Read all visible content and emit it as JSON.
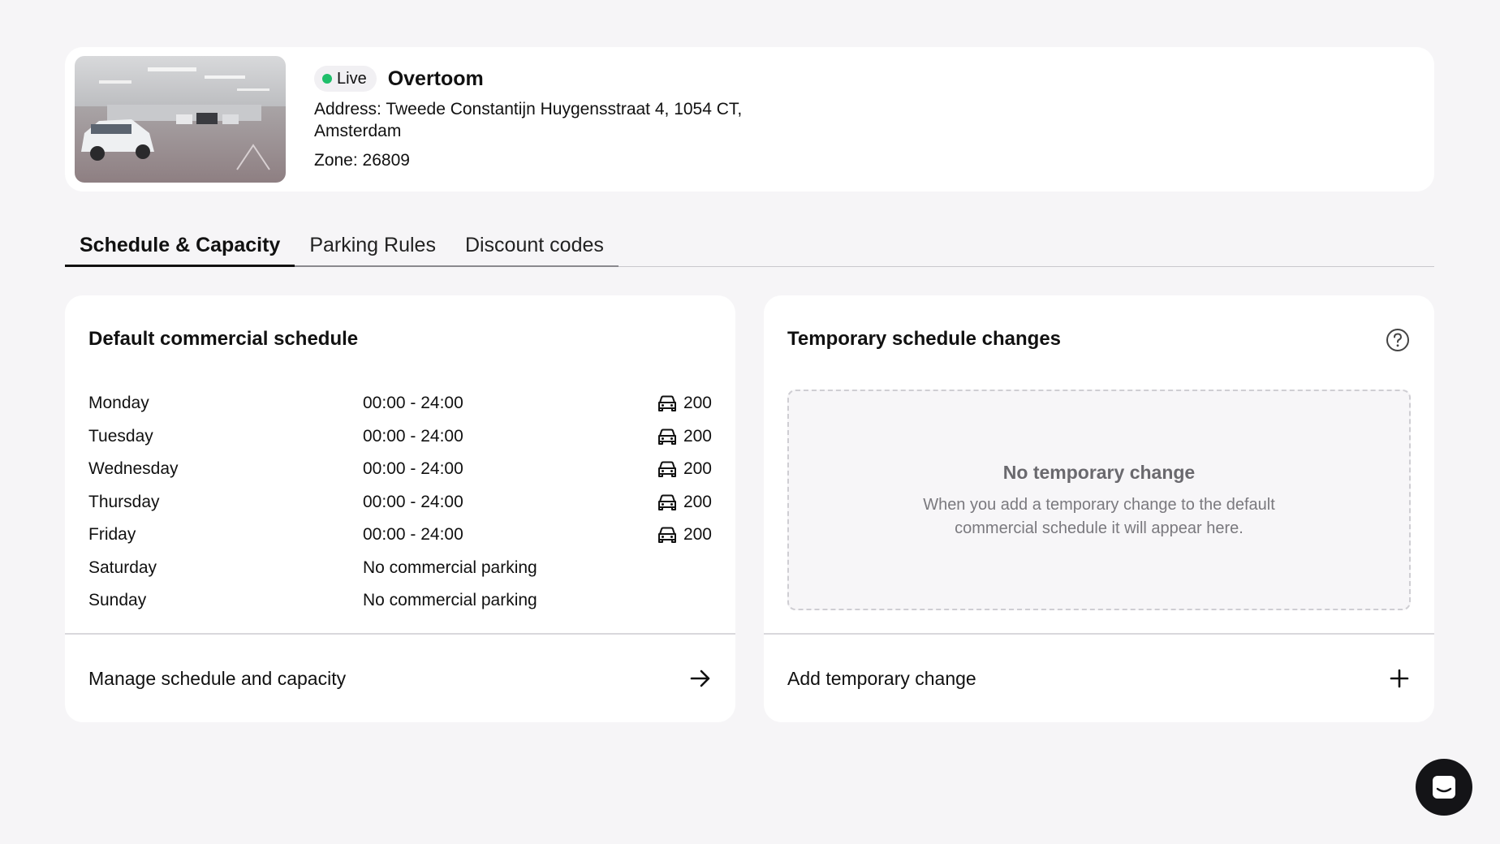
{
  "location": {
    "status": "Live",
    "name": "Overtoom",
    "address": "Address: Tweede Constantijn Huygensstraat 4, 1054 CT, Amsterdam",
    "zone": "Zone: 26809",
    "status_color": "#1fbf6a"
  },
  "tabs": [
    {
      "label": "Schedule & Capacity",
      "active": true
    },
    {
      "label": "Parking Rules",
      "active": false
    },
    {
      "label": "Discount codes",
      "active": false
    }
  ],
  "default_schedule": {
    "title": "Default commercial schedule",
    "rows": [
      {
        "day": "Monday",
        "hours": "00:00  -  24:00",
        "capacity": "200"
      },
      {
        "day": "Tuesday",
        "hours": "00:00  -  24:00",
        "capacity": "200"
      },
      {
        "day": "Wednesday",
        "hours": "00:00  -  24:00",
        "capacity": "200"
      },
      {
        "day": "Thursday",
        "hours": "00:00  -  24:00",
        "capacity": "200"
      },
      {
        "day": "Friday",
        "hours": "00:00  -  24:00",
        "capacity": "200"
      },
      {
        "day": "Saturday",
        "hours": "No commercial parking",
        "capacity": ""
      },
      {
        "day": "Sunday",
        "hours": "No commercial parking",
        "capacity": ""
      }
    ],
    "footer_label": "Manage schedule and capacity",
    "footer_icon": "arrow-right-icon"
  },
  "temporary_changes": {
    "title": "Temporary schedule changes",
    "help_icon": "help-circle-icon",
    "empty_title": "No temporary change",
    "empty_text": "When you add a temporary change to the default commercial schedule it will appear here.",
    "footer_label": "Add temporary change",
    "footer_icon": "plus-icon"
  },
  "icons": {
    "capacity": "car-icon",
    "chat": "chat-icon"
  }
}
